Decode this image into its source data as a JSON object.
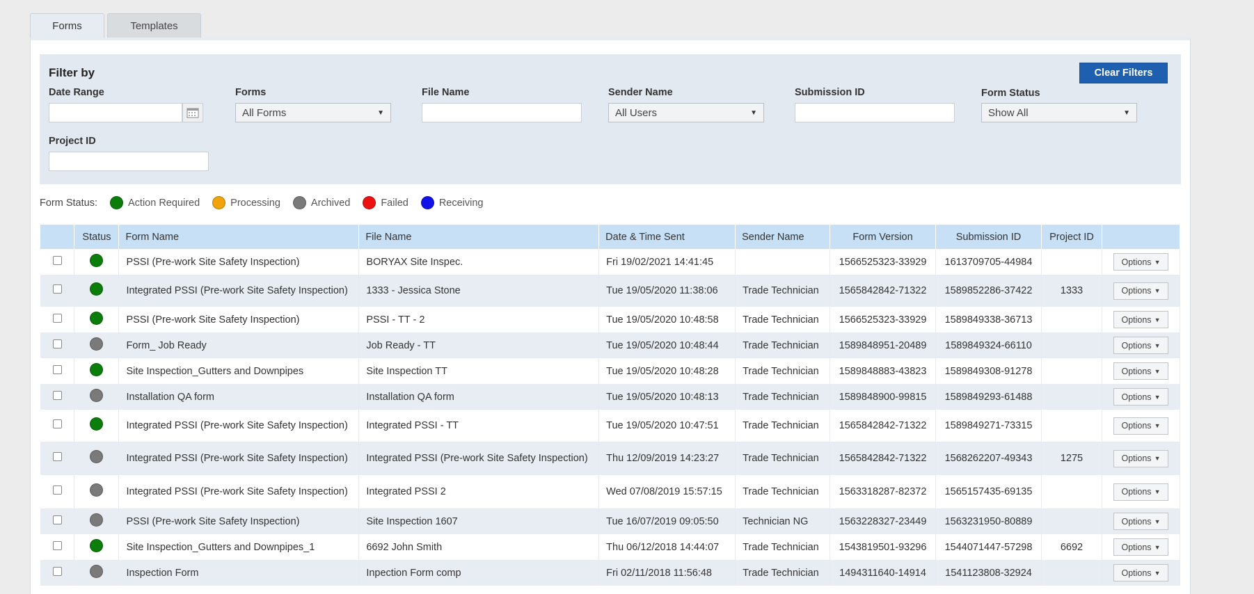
{
  "tabs": [
    {
      "label": "Forms",
      "active": true
    },
    {
      "label": "Templates",
      "active": false
    }
  ],
  "filter": {
    "title": "Filter by",
    "clear_label": "Clear Filters",
    "date_range_label": "Date Range",
    "date_range_value": "",
    "forms_label": "Forms",
    "forms_value": "All Forms",
    "file_name_label": "File Name",
    "file_name_value": "",
    "sender_label": "Sender Name",
    "sender_value": "All Users",
    "submission_label": "Submission ID",
    "submission_value": "",
    "status_label": "Form Status",
    "status_value": "Show All",
    "project_label": "Project ID",
    "project_value": ""
  },
  "legend": {
    "label": "Form Status:",
    "items": [
      {
        "label": "Action Required",
        "color": "#0a7d0a"
      },
      {
        "label": "Processing",
        "color": "#f0a30a"
      },
      {
        "label": "Archived",
        "color": "#7a7a7a"
      },
      {
        "label": "Failed",
        "color": "#ee1111"
      },
      {
        "label": "Receiving",
        "color": "#1212e8"
      }
    ]
  },
  "status_colors": {
    "green": "#0a7d0a",
    "grey": "#7a7a7a"
  },
  "table": {
    "headers": {
      "status": "Status",
      "form_name": "Form Name",
      "file_name": "File Name",
      "date_sent": "Date & Time Sent",
      "sender": "Sender Name",
      "form_version": "Form Version",
      "submission_id": "Submission ID",
      "project_id": "Project ID"
    },
    "options_label": "Options",
    "rows": [
      {
        "status": "green",
        "form_name": "PSSI (Pre-work Site Safety Inspection)",
        "file_name": "BORYAX Site Inspec.",
        "date": "Fri 19/02/2021 14:41:45",
        "sender": "",
        "version": "1566525323-33929",
        "submission": "1613709705-44984",
        "project": ""
      },
      {
        "status": "green",
        "form_name": "Integrated PSSI (Pre-work Site Safety Inspection)",
        "file_name": "1333 - Jessica Stone",
        "date": "Tue 19/05/2020 11:38:06",
        "sender": "Trade Technician",
        "version": "1565842842-71322",
        "submission": "1589852286-37422",
        "project": "1333"
      },
      {
        "status": "green",
        "form_name": "PSSI (Pre-work Site Safety Inspection)",
        "file_name": "PSSI - TT - 2",
        "date": "Tue 19/05/2020 10:48:58",
        "sender": "Trade Technician",
        "version": "1566525323-33929",
        "submission": "1589849338-36713",
        "project": ""
      },
      {
        "status": "grey",
        "form_name": "Form_ Job Ready",
        "file_name": "Job Ready - TT",
        "date": "Tue 19/05/2020 10:48:44",
        "sender": "Trade Technician",
        "version": "1589848951-20489",
        "submission": "1589849324-66110",
        "project": ""
      },
      {
        "status": "green",
        "form_name": "Site Inspection_Gutters and Downpipes",
        "file_name": "Site Inspection TT",
        "date": "Tue 19/05/2020 10:48:28",
        "sender": "Trade Technician",
        "version": "1589848883-43823",
        "submission": "1589849308-91278",
        "project": ""
      },
      {
        "status": "grey",
        "form_name": "Installation QA form",
        "file_name": "Installation QA form",
        "date": "Tue 19/05/2020 10:48:13",
        "sender": "Trade Technician",
        "version": "1589848900-99815",
        "submission": "1589849293-61488",
        "project": ""
      },
      {
        "status": "green",
        "form_name": "Integrated PSSI (Pre-work Site Safety Inspection)",
        "file_name": "Integrated PSSI - TT",
        "date": "Tue 19/05/2020 10:47:51",
        "sender": "Trade Technician",
        "version": "1565842842-71322",
        "submission": "1589849271-73315",
        "project": ""
      },
      {
        "status": "grey",
        "form_name": "Integrated PSSI (Pre-work Site Safety Inspection)",
        "file_name": "Integrated PSSI (Pre-work Site Safety Inspection)",
        "date": "Thu 12/09/2019 14:23:27",
        "sender": "Trade Technician",
        "version": "1565842842-71322",
        "submission": "1568262207-49343",
        "project": "1275"
      },
      {
        "status": "grey",
        "form_name": "Integrated PSSI (Pre-work Site Safety Inspection)",
        "file_name": "Integrated PSSI 2",
        "date": "Wed 07/08/2019 15:57:15",
        "sender": "Trade Technician",
        "version": "1563318287-82372",
        "submission": "1565157435-69135",
        "project": ""
      },
      {
        "status": "grey",
        "form_name": "PSSI (Pre-work Site Safety Inspection)",
        "file_name": "Site Inspection 1607",
        "date": "Tue 16/07/2019 09:05:50",
        "sender": "Technician NG",
        "version": "1563228327-23449",
        "submission": "1563231950-80889",
        "project": ""
      },
      {
        "status": "green",
        "form_name": "Site Inspection_Gutters and Downpipes_1",
        "file_name": "6692 John Smith",
        "date": "Thu 06/12/2018 14:44:07",
        "sender": "Trade Technician",
        "version": "1543819501-93296",
        "submission": "1544071447-57298",
        "project": "6692"
      },
      {
        "status": "grey",
        "form_name": "Inspection Form",
        "file_name": "Inpection Form comp",
        "date": "Fri 02/11/2018 11:56:48",
        "sender": "Trade Technician",
        "version": "1494311640-14914",
        "submission": "1541123808-32924",
        "project": ""
      }
    ]
  }
}
